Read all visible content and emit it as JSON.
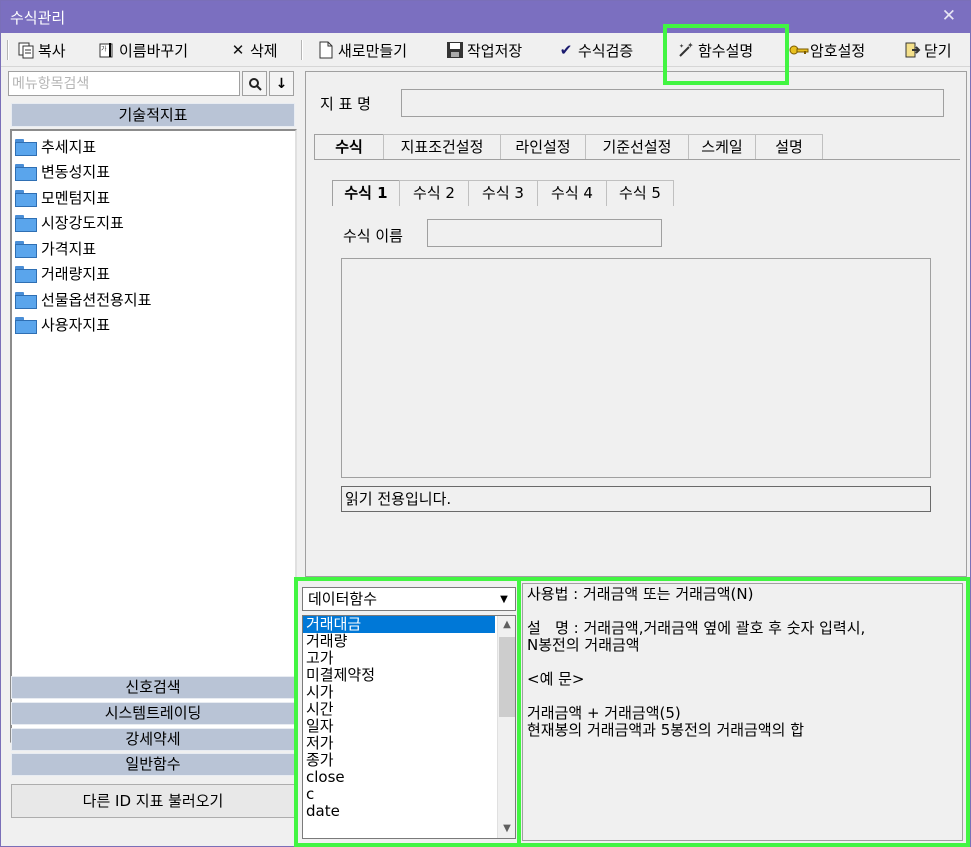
{
  "window": {
    "title": "수식관리",
    "close_symbol": "✕"
  },
  "toolbar": {
    "copy": "복사",
    "rename": "이름바꾸기",
    "delete": "삭제",
    "new": "새로만들기",
    "save": "작업저장",
    "verify": "수식검증",
    "func_desc": "함수설명",
    "password": "암호설정",
    "close": "닫기"
  },
  "left": {
    "search_placeholder": "메뉴항목검색",
    "search_icon": "search-icon",
    "down_icon": "arrow-down-icon",
    "category_header": "기술적지표",
    "tree_items": [
      "추세지표",
      "변동성지표",
      "모멘텀지표",
      "시장강도지표",
      "가격지표",
      "거래량지표",
      "선물옵션전용지표",
      "사용자지표"
    ],
    "categories": [
      "신호검색",
      "시스템트레이딩",
      "강세약세",
      "일반함수"
    ],
    "load_button": "다른 ID 지표 불러오기"
  },
  "main": {
    "indicator_label": "지 표 명",
    "indicator_value": "",
    "tabs": [
      "수식",
      "지표조건설정",
      "라인설정",
      "기준선설정",
      "스케일",
      "설명"
    ],
    "formula_tabs": [
      "수식 1",
      "수식 2",
      "수식 3",
      "수식 4",
      "수식 5"
    ],
    "formula_name_label": "수식 이름",
    "formula_name_value": "",
    "readonly_text": "읽기 전용입니다."
  },
  "functions": {
    "selected_category": "데이터함수",
    "items": [
      "거래대금",
      "거래량",
      "고가",
      "미결제약정",
      "시가",
      "시간",
      "일자",
      "저가",
      "종가",
      "close",
      "c",
      "date"
    ],
    "selected_index": 0
  },
  "description": {
    "usage": "사용법 : 거래금액 또는 거래금액(N)",
    "explain": "설   명 : 거래금액,거래금액 옆에 괄호 후 숫자 입력시,\nN봉전의 거래금액",
    "example_header": "<예 문>",
    "example_code": "거래금액 + 거래금액(5)",
    "example_desc": "현재봉의 거래금액과 5봉전의 거래금액의 합"
  },
  "colors": {
    "titlebar": "#7b6fc0",
    "highlight": "#42f542",
    "category_bg": "#b9c4d6",
    "selection": "#0078d7"
  }
}
